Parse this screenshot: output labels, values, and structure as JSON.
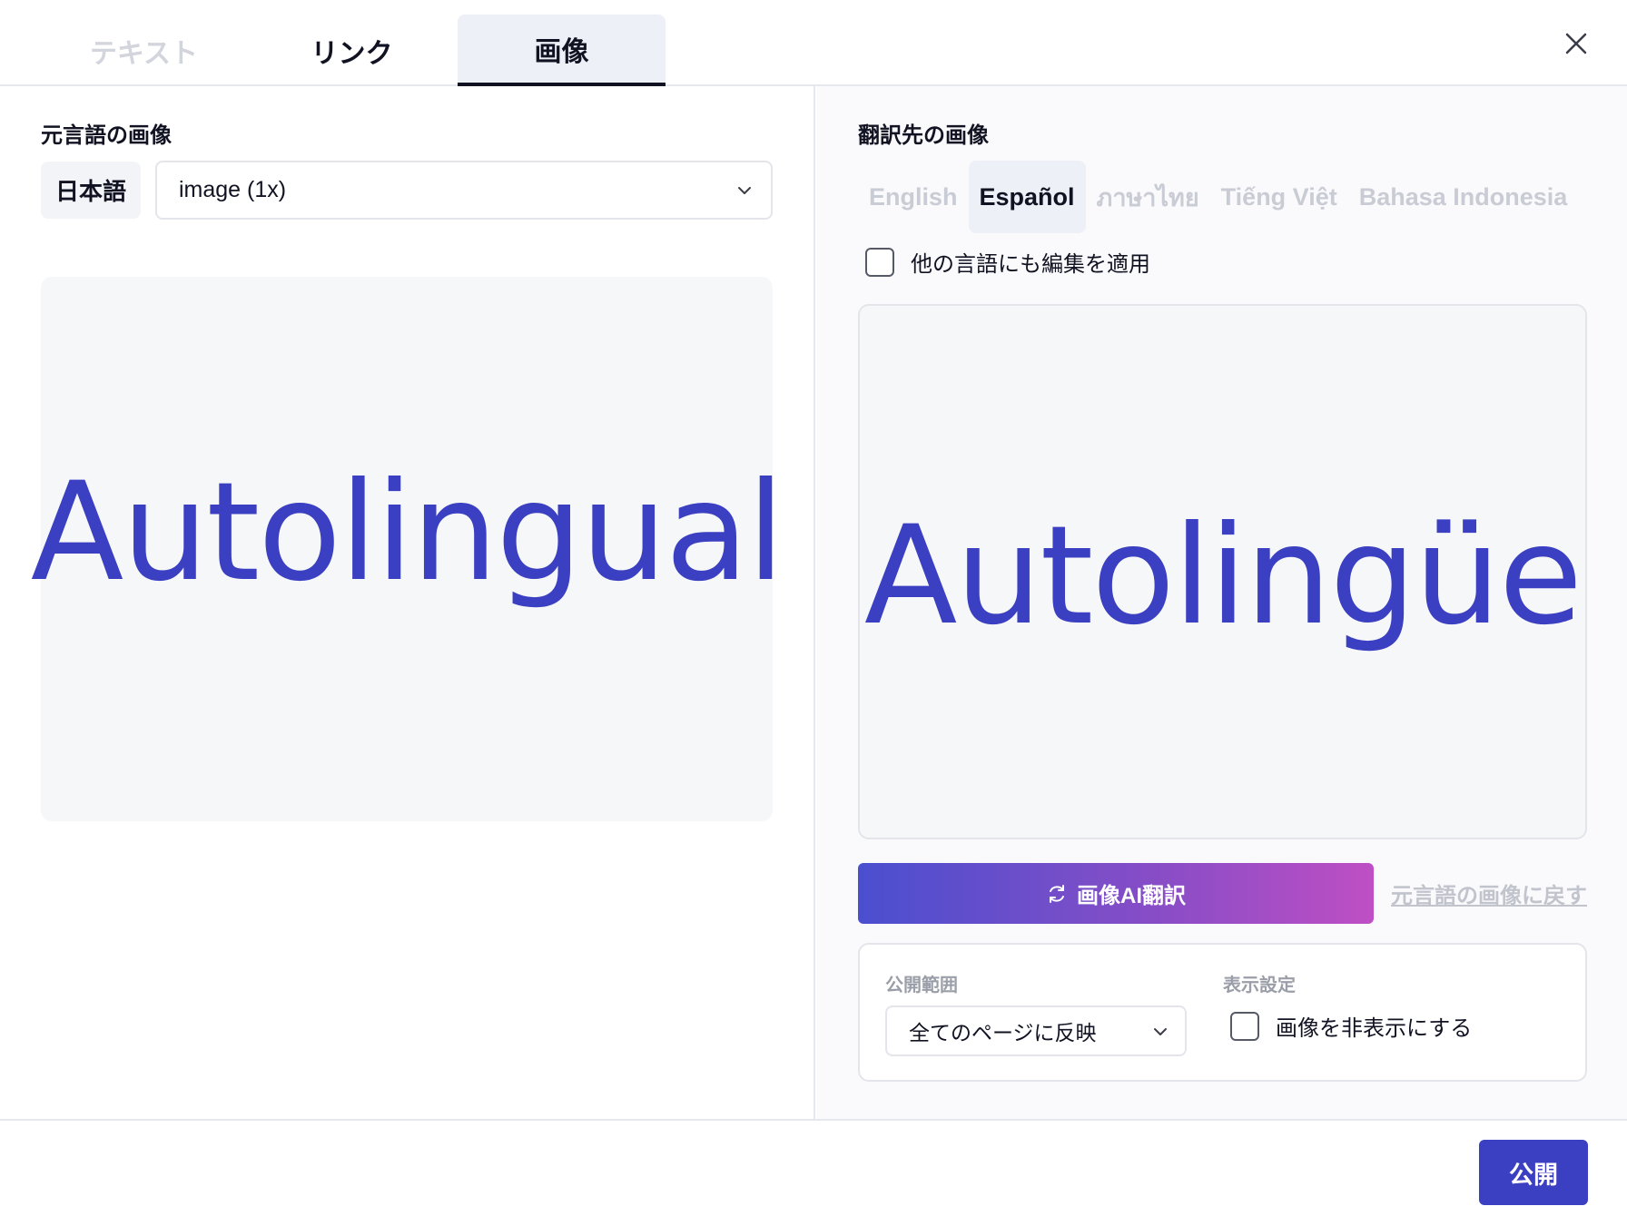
{
  "tabs": [
    {
      "label": "テキスト",
      "state": "disabled"
    },
    {
      "label": "リンク",
      "state": "normal"
    },
    {
      "label": "画像",
      "state": "selected"
    }
  ],
  "source": {
    "title": "元言語の画像",
    "language": "日本語",
    "image_select_value": "image (1x)",
    "image_text": "Autolingual"
  },
  "target": {
    "title": "翻訳先の画像",
    "languages": [
      {
        "label": "English",
        "active": false
      },
      {
        "label": "Español",
        "active": true
      },
      {
        "label": "ภาษาไทย",
        "active": false
      },
      {
        "label": "Tiếng Việt",
        "active": false
      },
      {
        "label": "Bahasa Indonesia",
        "active": false
      }
    ],
    "apply_all_label": "他の言語にも編集を適用",
    "apply_all_checked": false,
    "image_text": "Autolingüe",
    "ai_translate_label": "画像AI翻訳",
    "revert_label": "元言語の画像に戻す",
    "scope_label": "公開範囲",
    "scope_value": "全てのページに反映",
    "display_label": "表示設定",
    "hide_image_label": "画像を非表示にする",
    "hide_image_checked": false
  },
  "footer": {
    "publish_label": "公開"
  },
  "colors": {
    "accent": "#3b3fc1",
    "gradient_start": "#4a4fcf",
    "gradient_end": "#bf4fc4"
  },
  "icons": {
    "close": "close-icon",
    "chevron": "chevron-down-icon",
    "refresh": "refresh-icon"
  }
}
